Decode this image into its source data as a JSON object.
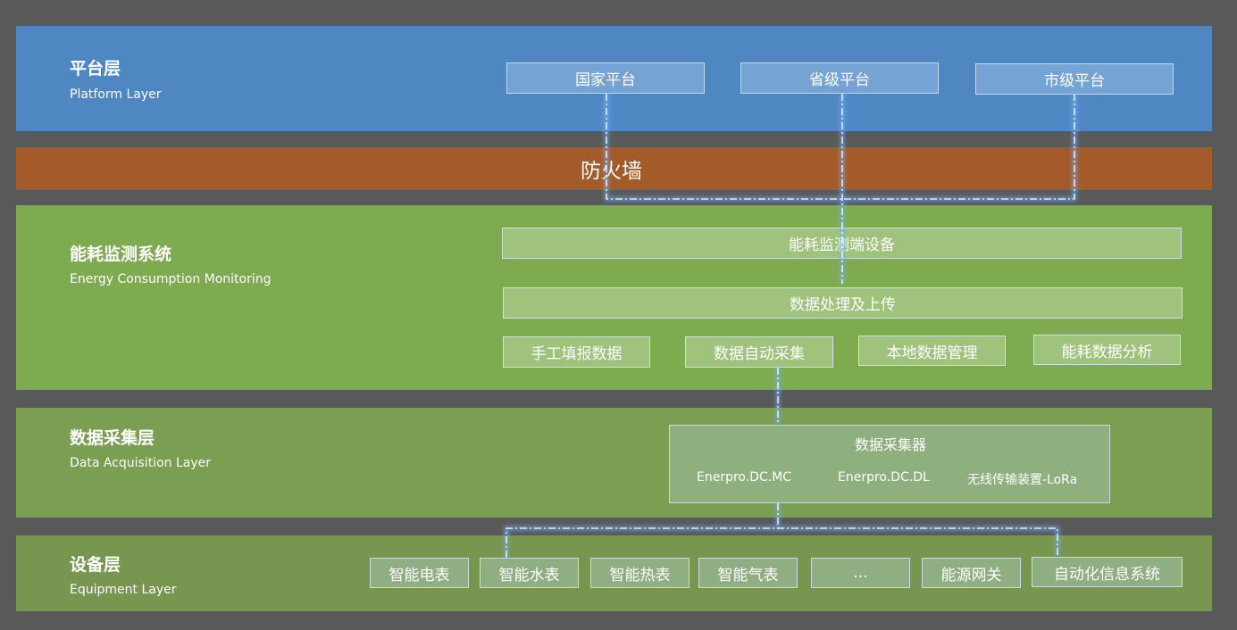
{
  "platform": {
    "title": "平台层",
    "subtitle": "Platform Layer",
    "boxes": [
      "国家平台",
      "省级平台",
      "市级平台"
    ]
  },
  "firewall": {
    "label": "防火墙"
  },
  "energy": {
    "title": "能耗监测系统",
    "subtitle": "Energy Consumption Monitoring",
    "device": "能耗监测端设备",
    "processing": "数据处理及上传",
    "modules": [
      "手工填报数据",
      "数据自动采集",
      "本地数据管理",
      "能耗数据分析"
    ]
  },
  "acquisition": {
    "title": "数据采集层",
    "subtitle": "Data Acquisition Layer",
    "collector": "数据采集器",
    "items": [
      "Enerpro.DC.MC",
      "Enerpro.DC.DL",
      "无线传输装置-LoRa"
    ]
  },
  "equipment": {
    "title": "设备层",
    "subtitle": "Equipment Layer",
    "items": [
      "智能电表",
      "智能水表",
      "智能热表",
      "智能气表",
      "...",
      "能源网关",
      "自动化信息系统"
    ]
  },
  "colors": {
    "platform": "#4f87c3",
    "firewall": "#a55a29",
    "energy": "#7eab50",
    "acquisition": "#7a9f52",
    "equipment": "#78964f",
    "background": "#595959"
  }
}
